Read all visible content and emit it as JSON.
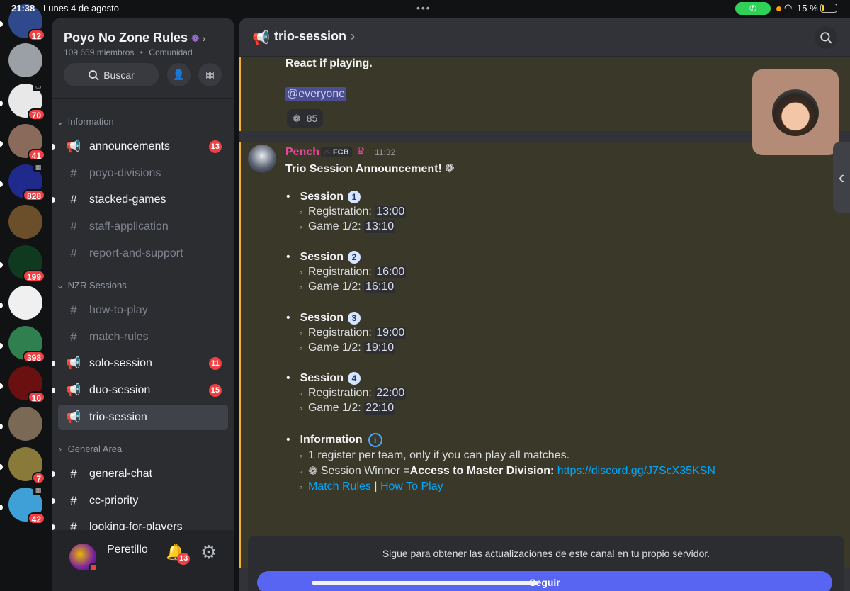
{
  "status_bar": {
    "time": "21:38",
    "date": "Lunes 4 de agosto",
    "battery": "15 %",
    "call_color": "#30d158"
  },
  "server_rail": {
    "servers": [
      {
        "badge": "12",
        "color": "#2e4a8c"
      },
      {
        "badge": "",
        "color": "#9aa0a6"
      },
      {
        "badge": "70",
        "color": "#e8e8e8"
      },
      {
        "badge": "41",
        "color": "#8a6a5a"
      },
      {
        "badge": "828",
        "color": "#1f2a8c"
      },
      {
        "badge": "",
        "color": "#6b4f2a"
      },
      {
        "badge": "199",
        "color": "#0f3a20"
      },
      {
        "badge": "",
        "color": "#f0f0f0"
      },
      {
        "badge": "398",
        "color": "#2f7f4f"
      },
      {
        "badge": "10",
        "color": "#6a1010"
      },
      {
        "badge": "",
        "color": "#7a6a55"
      },
      {
        "badge": "7",
        "color": "#8a7a3a"
      },
      {
        "badge": "42",
        "color": "#3fa0d8"
      }
    ]
  },
  "server": {
    "name": "Poyo No Zone Rules",
    "members": "109.659 miembros",
    "type": "Comunidad",
    "search_label": "Buscar"
  },
  "categories": [
    {
      "label": "Information"
    },
    {
      "label": "NZR Sessions"
    },
    {
      "label": "General Area"
    }
  ],
  "channels": [
    {
      "name": "announcements",
      "icon": "megaphone-icon",
      "badge": "13"
    },
    {
      "name": "poyo-divisions",
      "icon": "hash-icon",
      "badge": ""
    },
    {
      "name": "stacked-games",
      "icon": "hash-icon",
      "badge": ""
    },
    {
      "name": "staff-application",
      "icon": "hash-icon",
      "badge": ""
    },
    {
      "name": "report-and-support",
      "icon": "hash-icon",
      "badge": ""
    },
    {
      "name": "how-to-play",
      "icon": "hash-icon",
      "badge": ""
    },
    {
      "name": "match-rules",
      "icon": "hash-icon",
      "badge": ""
    },
    {
      "name": "solo-session",
      "icon": "megaphone-icon",
      "badge": "11"
    },
    {
      "name": "duo-session",
      "icon": "megaphone-icon",
      "badge": "15"
    },
    {
      "name": "trio-session",
      "icon": "megaphone-icon",
      "badge": ""
    },
    {
      "name": "general-chat",
      "icon": "hash-icon",
      "badge": ""
    },
    {
      "name": "cc-priority",
      "icon": "hash-icon",
      "badge": ""
    },
    {
      "name": "looking-for-players",
      "icon": "hash-icon",
      "badge": ""
    }
  ],
  "user": {
    "name": "Peretillo",
    "notifications": "13"
  },
  "header": {
    "channel": "trio-session"
  },
  "previous_message": {
    "text": "React if playing.",
    "mention": "@everyone",
    "reaction_count": "85"
  },
  "message": {
    "author": "Pench",
    "tag": "FCB",
    "time": "11:32",
    "heading": "Trio Session Announcement!",
    "session_label": "Session",
    "sessions": [
      {
        "num": "1",
        "registration": "13:00",
        "game": "13:10"
      },
      {
        "num": "2",
        "registration": "16:00",
        "game": "16:10"
      },
      {
        "num": "3",
        "registration": "19:00",
        "game": "19:10"
      },
      {
        "num": "4",
        "registration": "22:00",
        "game": "22:10"
      }
    ],
    "registration_label": "Registration:",
    "game_label": "Game 1/2:",
    "info_label": "Information",
    "info_rule": "1 register per team, only if you can play all matches.",
    "winner_prefix": "Session Winner = ",
    "winner_bold": "Access to Master Division:",
    "invite_link": "https://discord.gg/J7ScX35KSN",
    "link_match_rules": "Match Rules",
    "link_separator": "|",
    "link_how_to_play": "How To Play"
  },
  "follow_banner": {
    "text": "Sigue para obtener las actualizaciones de este canal en tu propio servidor.",
    "button": "Seguir"
  },
  "colors": {
    "accent": "#5865f2",
    "mention_bg": "#4c4f8f",
    "highlight_border": "#f0b232",
    "author": "#eb459e",
    "badge": "#f23f43",
    "link": "#00a8fc"
  }
}
